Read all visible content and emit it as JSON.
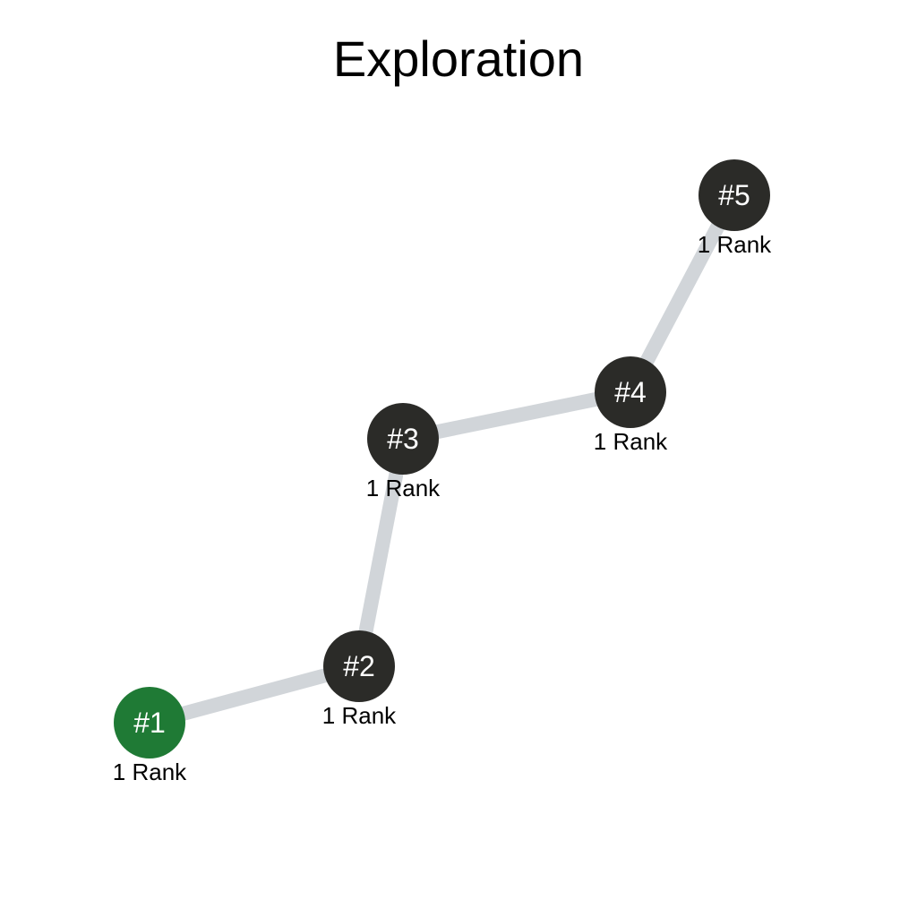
{
  "title": "Exploration",
  "colors": {
    "edge": "#d1d5d9",
    "node_default": "#2b2b28",
    "node_active": "#1f7a35",
    "node_text": "#ffffff",
    "rank_text": "#000000"
  },
  "nodes": [
    {
      "id": "1",
      "label": "#1",
      "rank": "1 Rank",
      "active": true
    },
    {
      "id": "2",
      "label": "#2",
      "rank": "1 Rank",
      "active": false
    },
    {
      "id": "3",
      "label": "#3",
      "rank": "1 Rank",
      "active": false
    },
    {
      "id": "4",
      "label": "#4",
      "rank": "1 Rank",
      "active": false
    },
    {
      "id": "5",
      "label": "#5",
      "rank": "1 Rank",
      "active": false
    }
  ],
  "edges": [
    {
      "from": "1",
      "to": "2"
    },
    {
      "from": "2",
      "to": "3"
    },
    {
      "from": "3",
      "to": "4"
    },
    {
      "from": "4",
      "to": "5"
    }
  ]
}
